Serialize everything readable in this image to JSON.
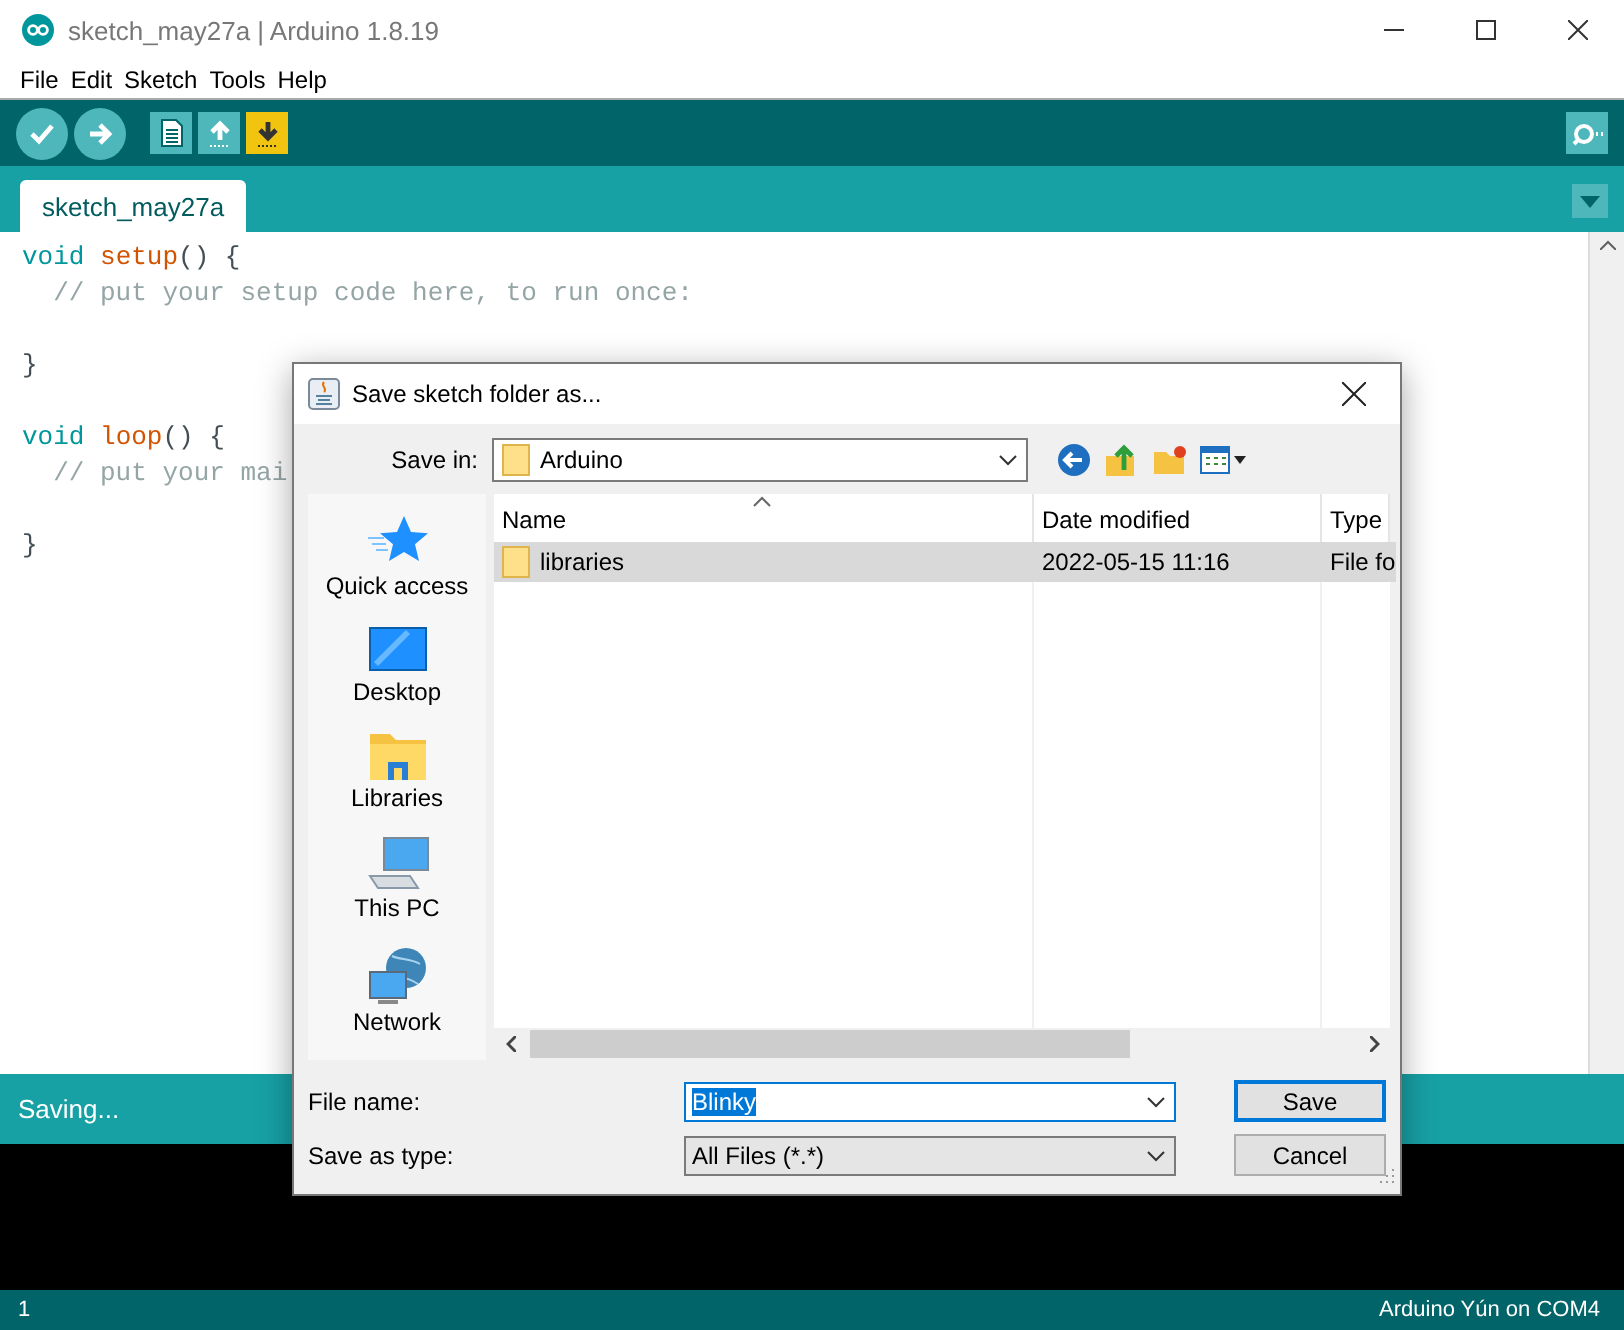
{
  "window": {
    "title": "sketch_may27a | Arduino 1.8.19"
  },
  "menu": [
    "File",
    "Edit",
    "Sketch",
    "Tools",
    "Help"
  ],
  "toolbar": [
    {
      "kind": "verify",
      "highlighted": false
    },
    {
      "kind": "upload",
      "highlighted": false
    },
    {
      "kind": "new",
      "highlighted": false
    },
    {
      "kind": "open",
      "highlighted": false
    },
    {
      "kind": "save",
      "highlighted": true
    }
  ],
  "tabs": [
    {
      "label": "sketch_may27a",
      "selected": true
    }
  ],
  "code_blocks": [
    [
      [
        {
          "text": "void",
          "kind": "type"
        },
        {
          "text": " setup",
          "kind": "func"
        },
        {
          "text": "() {",
          "kind": "plain"
        }
      ],
      [
        {
          "text": "  // put your setup code here, to run once:",
          "kind": "comment"
        }
      ]
    ],
    [
      [
        {
          "text": "}",
          "kind": "plain"
        }
      ]
    ],
    [
      [
        {
          "text": "void",
          "kind": "type"
        },
        {
          "text": " loop",
          "kind": "func"
        },
        {
          "text": "() {",
          "kind": "plain"
        }
      ],
      [
        {
          "text": "  // put your mai",
          "kind": "comment"
        }
      ]
    ],
    [
      [
        {
          "text": "}",
          "kind": "plain"
        }
      ]
    ]
  ],
  "status": "Saving...",
  "footer": {
    "line": "1",
    "board": "Arduino Yún on COM4"
  },
  "dialog": {
    "title": "Save sketch folder as...",
    "save_in_label": "Save in:",
    "save_in": "Arduino",
    "places": [
      {
        "label": "Quick access",
        "kind": "star"
      },
      {
        "label": "Desktop",
        "kind": "desktop"
      },
      {
        "label": "Libraries",
        "kind": "libraries"
      },
      {
        "label": "This PC",
        "kind": "pc"
      },
      {
        "label": "Network",
        "kind": "network"
      }
    ],
    "columns": [
      "Name",
      "Date modified",
      "Type"
    ],
    "rows": [
      {
        "name": "libraries",
        "date": "2022-05-15 11:16",
        "type": "File fo",
        "selected": true
      }
    ],
    "file_name_label": "File name:",
    "file_name": "Blinky",
    "file_name_selected": true,
    "type_label": "Save as type:",
    "type_value": "All Files (*.*)",
    "buttons": [
      {
        "label": "Save",
        "default": true
      },
      {
        "label": "Cancel",
        "default": false
      }
    ]
  }
}
